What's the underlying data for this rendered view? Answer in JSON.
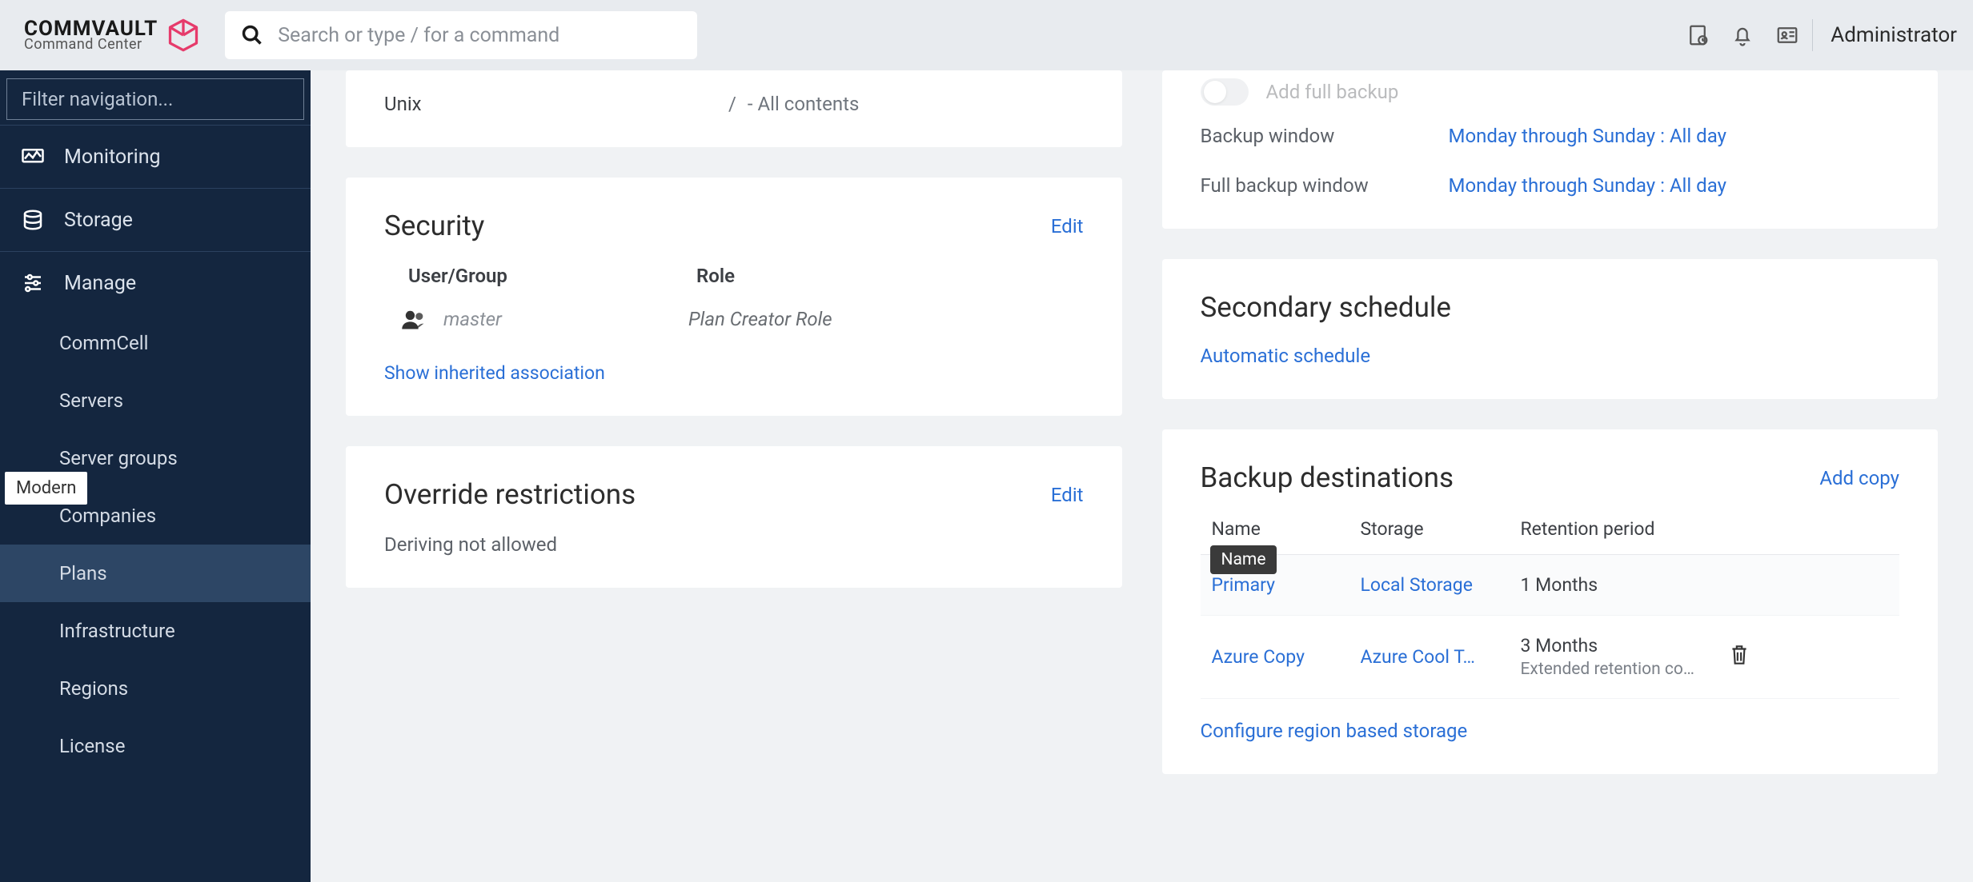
{
  "header": {
    "brand_main": "COMMVAULT",
    "brand_sub": "Command Center",
    "search_placeholder": "Search or type / for a command",
    "user_label": "Administrator"
  },
  "sidebar": {
    "filter_placeholder": "Filter navigation...",
    "items": [
      {
        "label": "Monitoring",
        "kind": "top"
      },
      {
        "label": "Storage",
        "kind": "top"
      },
      {
        "label": "Manage",
        "kind": "top"
      },
      {
        "label": "CommCell",
        "kind": "sub"
      },
      {
        "label": "Servers",
        "kind": "sub"
      },
      {
        "label": "Server groups",
        "kind": "sub"
      },
      {
        "label": "Companies",
        "kind": "sub"
      },
      {
        "label": "Plans",
        "kind": "sub",
        "active": true
      },
      {
        "label": "Infrastructure",
        "kind": "sub"
      },
      {
        "label": "Regions",
        "kind": "sub"
      },
      {
        "label": "License",
        "kind": "sub"
      }
    ],
    "modern_pill": "Modern"
  },
  "left": {
    "unix": {
      "label": "Unix",
      "slash": "/",
      "rest": "-  All contents"
    },
    "security": {
      "title": "Security",
      "edit": "Edit",
      "col1": "User/Group",
      "col2": "Role",
      "user": "master",
      "role": "Plan Creator Role",
      "inherited": "Show inherited association"
    },
    "override": {
      "title": "Override restrictions",
      "edit": "Edit",
      "body": "Deriving not allowed"
    }
  },
  "right": {
    "rpo": {
      "toggle_label": "Add full backup",
      "backup_window_k": "Backup window",
      "backup_window_v": "Monday through Sunday : All day",
      "full_window_k": "Full backup window",
      "full_window_v": "Monday through Sunday : All day"
    },
    "secondary": {
      "title": "Secondary schedule",
      "link": "Automatic schedule"
    },
    "dest": {
      "title": "Backup destinations",
      "add": "Add copy",
      "th_name": "Name",
      "th_storage": "Storage",
      "th_ret": "Retention period",
      "tooltip": "Name",
      "rows": [
        {
          "name": "Primary",
          "storage": "Local Storage",
          "ret": "1 Months",
          "ret_sub": ""
        },
        {
          "name": "Azure Copy",
          "storage": "Azure Cool T…",
          "ret": "3 Months",
          "ret_sub": "Extended retention co…"
        }
      ],
      "region_link": "Configure region based storage"
    }
  }
}
